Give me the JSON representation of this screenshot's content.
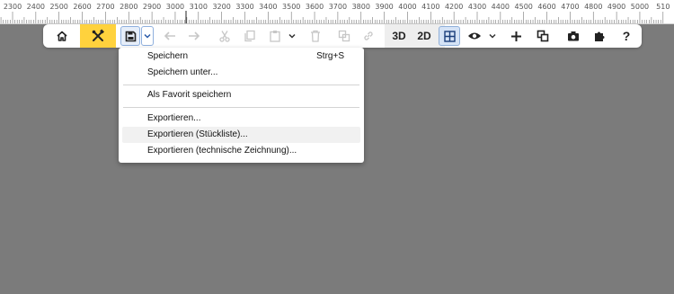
{
  "ruler": {
    "labels": [
      "2300",
      "2400",
      "2500",
      "2600",
      "2700",
      "2800",
      "2900",
      "3000",
      "3100",
      "3200",
      "3300",
      "3400",
      "3500",
      "3600",
      "3700",
      "3800",
      "3900",
      "4000",
      "4100",
      "4200",
      "4300",
      "4400",
      "4500",
      "4600",
      "4700",
      "4800",
      "4900",
      "5000",
      "510"
    ]
  },
  "toolbar": {
    "view_3d": "3D",
    "view_2d": "2D",
    "help": "?"
  },
  "menu": {
    "items": [
      {
        "label": "Speichern",
        "shortcut": "Strg+S"
      },
      {
        "label": "Speichern unter..."
      },
      {
        "label": "Als Favorit speichern"
      },
      {
        "label": "Exportieren..."
      },
      {
        "label": "Exportieren (Stückliste)..."
      },
      {
        "label": "Exportieren (technische Zeichnung)..."
      }
    ]
  },
  "colors": {
    "canvas": "#7b7b7b",
    "accent_yellow": "#ffd23d",
    "active_blue": "#d5e3f6"
  }
}
